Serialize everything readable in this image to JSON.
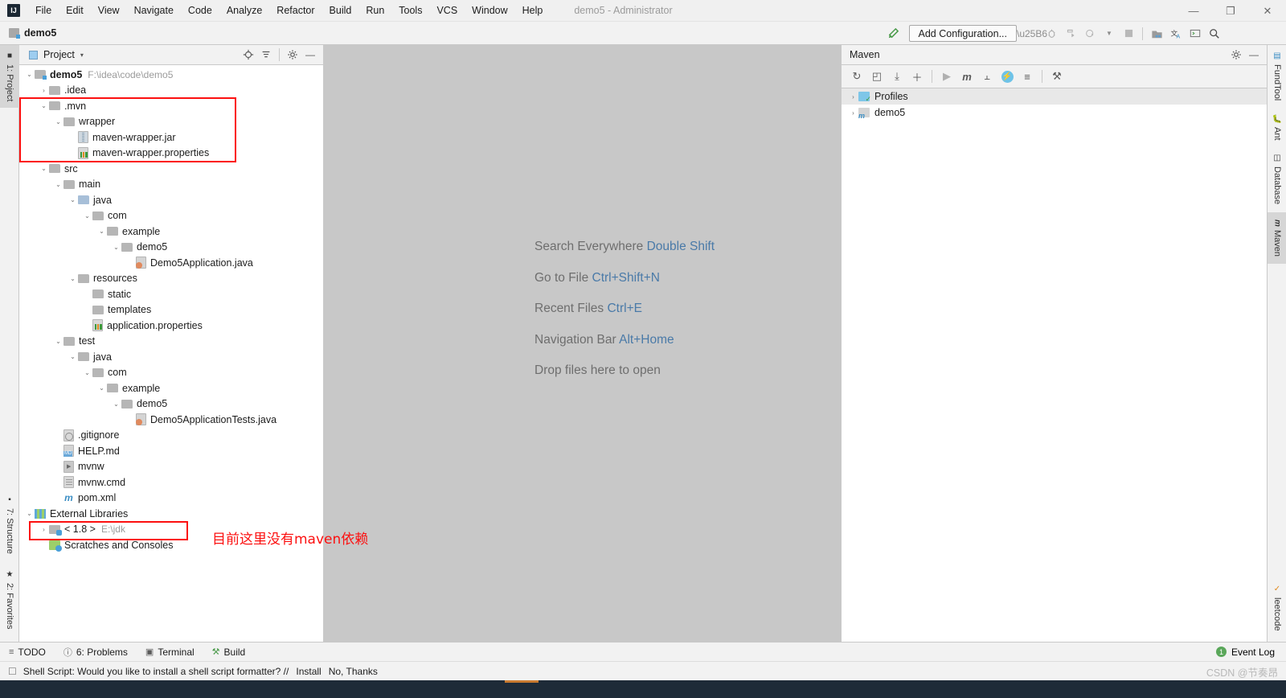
{
  "titlebar": {
    "logo": "IJ",
    "menus": [
      "File",
      "Edit",
      "View",
      "Navigate",
      "Code",
      "Analyze",
      "Refactor",
      "Build",
      "Run",
      "Tools",
      "VCS",
      "Window",
      "Help"
    ],
    "window_title": "demo5 - Administrator",
    "minimize": "—",
    "maximize": "❐",
    "close": "✕"
  },
  "navbar": {
    "breadcrumb": "demo5",
    "add_configuration": "Add Configuration...",
    "icons": [
      "hammer-icon",
      "run-icon",
      "debug-icon",
      "run-coverage-icon",
      "profile-icon",
      "dropdown-icon",
      "stop-icon",
      "project-structure-icon",
      "translate-icon",
      "terminal-icon",
      "search-icon"
    ]
  },
  "left_strip": {
    "tabs": [
      {
        "label": "1: Project",
        "icon": "project-icon",
        "selected": true
      },
      {
        "label": "7: Structure",
        "icon": "structure-icon",
        "selected": false
      },
      {
        "label": "2: Favorites",
        "icon": "star-icon",
        "selected": false
      }
    ]
  },
  "right_strip": {
    "tabs": [
      {
        "label": "FundTool",
        "icon": "chart-icon",
        "selected": false
      },
      {
        "label": "Ant",
        "icon": "ant-icon",
        "selected": false
      },
      {
        "label": "Database",
        "icon": "database-icon",
        "selected": false
      },
      {
        "label": "Maven",
        "icon": "maven-icon",
        "selected": true
      },
      {
        "label": "leetcode",
        "icon": "leetcode-icon",
        "selected": false
      }
    ]
  },
  "project_panel": {
    "title": "Project",
    "caret": "▾",
    "tools": [
      {
        "name": "locate-icon",
        "glyph": "⊕"
      },
      {
        "name": "collapse-all-icon",
        "glyph": "≡"
      },
      {
        "name": "gear-icon",
        "glyph": "⚙"
      },
      {
        "name": "hide-icon",
        "glyph": "—"
      }
    ],
    "tree": [
      {
        "indent": 0,
        "arrow": "⌄",
        "icon": "module-folder",
        "label": "demo5",
        "path": "F:\\idea\\code\\demo5",
        "bold": true
      },
      {
        "indent": 1,
        "arrow": "›",
        "icon": "folder",
        "label": ".idea",
        "path": ""
      },
      {
        "indent": 1,
        "arrow": "⌄",
        "icon": "folder",
        "label": ".mvn",
        "path": ""
      },
      {
        "indent": 2,
        "arrow": "⌄",
        "icon": "folder",
        "label": "wrapper",
        "path": ""
      },
      {
        "indent": 3,
        "arrow": "",
        "icon": "jar-file",
        "label": "maven-wrapper.jar",
        "path": ""
      },
      {
        "indent": 3,
        "arrow": "",
        "icon": "properties-file",
        "label": "maven-wrapper.properties",
        "path": ""
      },
      {
        "indent": 1,
        "arrow": "⌄",
        "icon": "folder",
        "label": "src",
        "path": ""
      },
      {
        "indent": 2,
        "arrow": "⌄",
        "icon": "folder",
        "label": "main",
        "path": ""
      },
      {
        "indent": 3,
        "arrow": "⌄",
        "icon": "source-folder",
        "label": "java",
        "path": ""
      },
      {
        "indent": 4,
        "arrow": "⌄",
        "icon": "folder",
        "label": "com",
        "path": ""
      },
      {
        "indent": 5,
        "arrow": "⌄",
        "icon": "folder",
        "label": "example",
        "path": ""
      },
      {
        "indent": 6,
        "arrow": "⌄",
        "icon": "folder",
        "label": "demo5",
        "path": ""
      },
      {
        "indent": 7,
        "arrow": "",
        "icon": "java-file",
        "label": "Demo5Application.java",
        "path": ""
      },
      {
        "indent": 3,
        "arrow": "⌄",
        "icon": "resource-folder",
        "label": "resources",
        "path": ""
      },
      {
        "indent": 4,
        "arrow": "",
        "icon": "folder",
        "label": "static",
        "path": ""
      },
      {
        "indent": 4,
        "arrow": "",
        "icon": "folder",
        "label": "templates",
        "path": ""
      },
      {
        "indent": 4,
        "arrow": "",
        "icon": "properties-file",
        "label": "application.properties",
        "path": ""
      },
      {
        "indent": 2,
        "arrow": "⌄",
        "icon": "folder",
        "label": "test",
        "path": ""
      },
      {
        "indent": 3,
        "arrow": "⌄",
        "icon": "test-source-folder",
        "label": "java",
        "path": ""
      },
      {
        "indent": 4,
        "arrow": "⌄",
        "icon": "folder",
        "label": "com",
        "path": ""
      },
      {
        "indent": 5,
        "arrow": "⌄",
        "icon": "folder",
        "label": "example",
        "path": ""
      },
      {
        "indent": 6,
        "arrow": "⌄",
        "icon": "folder",
        "label": "demo5",
        "path": ""
      },
      {
        "indent": 7,
        "arrow": "",
        "icon": "java-file",
        "label": "Demo5ApplicationTests.java",
        "path": ""
      },
      {
        "indent": 2,
        "arrow": "",
        "icon": "gitignore-file",
        "label": ".gitignore",
        "path": ""
      },
      {
        "indent": 2,
        "arrow": "",
        "icon": "markdown-file",
        "label": "HELP.md",
        "path": ""
      },
      {
        "indent": 2,
        "arrow": "",
        "icon": "shell-file",
        "label": "mvnw",
        "path": ""
      },
      {
        "indent": 2,
        "arrow": "",
        "icon": "cmd-file",
        "label": "mvnw.cmd",
        "path": ""
      },
      {
        "indent": 2,
        "arrow": "",
        "icon": "maven-pom-file",
        "label": "pom.xml",
        "path": ""
      },
      {
        "indent": 0,
        "arrow": "⌄",
        "icon": "library-icon",
        "label": "External Libraries",
        "path": ""
      },
      {
        "indent": 1,
        "arrow": "›",
        "icon": "jdk-icon",
        "label": "< 1.8 >",
        "path": "E:\\jdk"
      },
      {
        "indent": 1,
        "arrow": "",
        "icon": "scratches-icon",
        "label": "Scratches and Consoles",
        "path": ""
      }
    ]
  },
  "editor": {
    "shortcuts": [
      {
        "action": "Search Everywhere",
        "key": "Double Shift"
      },
      {
        "action": "Go to File",
        "key": "Ctrl+Shift+N"
      },
      {
        "action": "Recent Files",
        "key": "Ctrl+E"
      },
      {
        "action": "Navigation Bar",
        "key": "Alt+Home"
      },
      {
        "action": "Drop files here to open",
        "key": ""
      }
    ]
  },
  "maven_panel": {
    "title": "Maven",
    "tools": [
      {
        "name": "reload-icon",
        "glyph": "↻",
        "dim": false
      },
      {
        "name": "add-maven-project-icon",
        "glyph": "◰",
        "dim": false
      },
      {
        "name": "download-sources-icon",
        "glyph": "⤓",
        "dim": false
      },
      {
        "name": "add-icon",
        "glyph": "＋",
        "dim": false
      },
      {
        "name": "run-icon",
        "glyph": "▶",
        "dim": true
      },
      {
        "name": "execute-maven-goal-icon",
        "glyph": "m",
        "dim": false
      },
      {
        "name": "skip-tests-icon",
        "glyph": "⫠",
        "dim": false
      },
      {
        "name": "toggle-offline-icon",
        "glyph": "⚡",
        "dim": false
      },
      {
        "name": "collapse-all-icon",
        "glyph": "≡",
        "dim": false
      },
      {
        "name": "settings-wrench-icon",
        "glyph": "⚒",
        "dim": false
      }
    ],
    "gear": "⚙",
    "hide": "—",
    "tree": [
      {
        "label": "Profiles",
        "icon": "profiles-icon",
        "arrow": "›",
        "selected": true
      },
      {
        "label": "demo5",
        "icon": "maven-project-icon",
        "arrow": "›",
        "selected": false
      }
    ]
  },
  "bottom_toolbar": {
    "items": [
      {
        "label": "TODO",
        "icon": "todo-icon",
        "glyph": "≡"
      },
      {
        "label": "6: Problems",
        "icon": "problems-icon",
        "glyph": "ⓘ"
      },
      {
        "label": "Terminal",
        "icon": "terminal-icon",
        "glyph": "▣"
      },
      {
        "label": "Build",
        "icon": "build-hammer-icon",
        "glyph": "⚒"
      }
    ],
    "event_log": "Event Log",
    "event_count": "1"
  },
  "statusbar": {
    "icon": "notification-icon",
    "message": "Shell Script: Would you like to install a shell script formatter? //",
    "install_link": "Install",
    "dismiss_link": "No, Thanks"
  },
  "watermark": "CSDN @节奏昂",
  "annotations": {
    "box1_target": ".mvn wrapper folder group",
    "box2_target": "JDK external library row",
    "note_text": "目前这里没有maven依赖",
    "color": "#fc1010"
  }
}
